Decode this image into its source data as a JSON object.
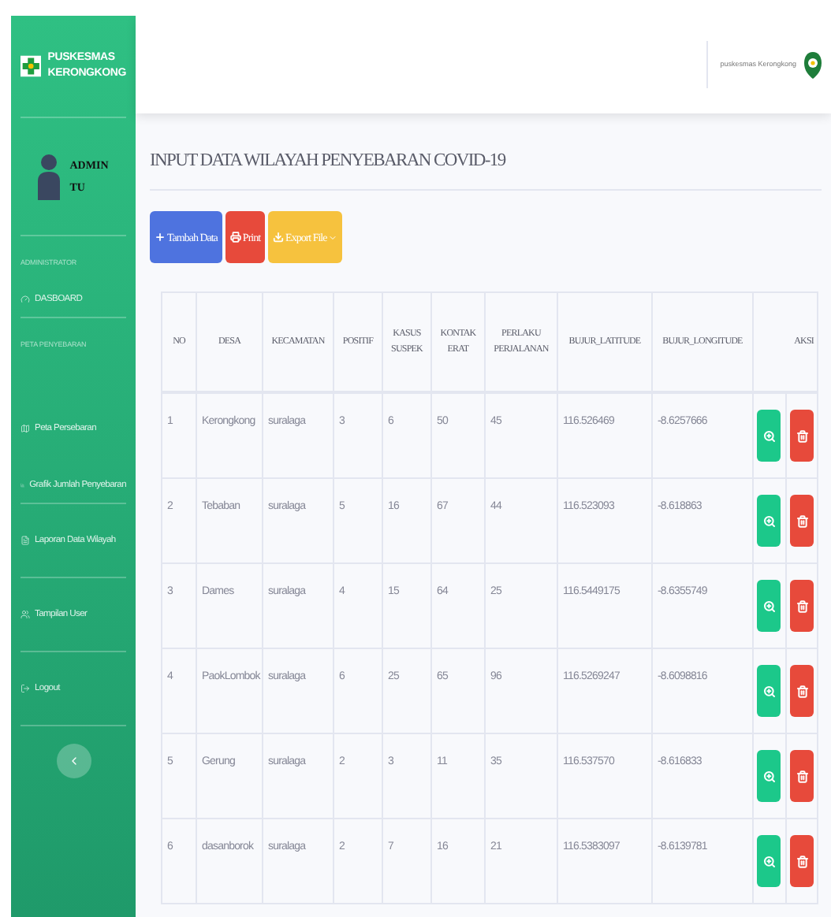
{
  "sidebar": {
    "brand": [
      "PUSKESMAS",
      "KERONGKONG"
    ],
    "user": [
      "ADMIN",
      "TU"
    ],
    "sections": [
      {
        "heading": "ADMINISTRATOR",
        "items": [
          {
            "label": "DASBOARD",
            "kind": "dashboard"
          }
        ]
      },
      {
        "heading": "PETA PENYEBARAN",
        "items": [
          {
            "label": "Peta Persebaran",
            "kind": "map"
          },
          {
            "label": "Grafik Jumlah Penyebaran",
            "kind": "chart"
          }
        ]
      },
      {
        "items": [
          {
            "label": "Laporan Data Wilayah",
            "kind": "report"
          }
        ]
      },
      {
        "items": [
          {
            "label": "Tampilan User",
            "kind": "users"
          }
        ]
      },
      {
        "items": [
          {
            "label": "Logout",
            "kind": "logout"
          }
        ]
      }
    ]
  },
  "topbar": {
    "user_label": "puskesmas Kerongkong"
  },
  "page_title": "INPUT DATA WILAYAH PENYEBARAN COVID-19",
  "buttons": [
    {
      "label": "Tambah Data",
      "kind": "add"
    },
    {
      "label": "Print",
      "kind": "print"
    },
    {
      "label": "Export File",
      "kind": "export"
    }
  ],
  "table": {
    "columns": [
      "NO",
      "DESA",
      "KECAMATAN",
      "POSITIF",
      "KASUS SUSPEK",
      "KONTAK ERAT",
      "PERLAKU PERJALANAN",
      "BUJUR_LATITUDE",
      "BUJUR_LONGITUDE",
      "AKSI"
    ],
    "rows": [
      [
        "1",
        "Kerongkong",
        "suralaga",
        "3",
        "6",
        "50",
        "45",
        "116.526469",
        "-8.6257666"
      ],
      [
        "2",
        "Tebaban",
        "suralaga",
        "5",
        "16",
        "67",
        "44",
        "116.523093",
        "-8.618863"
      ],
      [
        "3",
        "Dames",
        "suralaga",
        "4",
        "15",
        "64",
        "25",
        "116.5449175",
        "-8.6355749"
      ],
      [
        "4",
        "PaokLombok",
        "suralaga",
        "6",
        "25",
        "65",
        "96",
        "116.5269247",
        "-8.6098816"
      ],
      [
        "5",
        "Gerung",
        "suralaga",
        "2",
        "3",
        "11",
        "35",
        "116.537570",
        "-8.616833"
      ],
      [
        "6",
        "dasanborok",
        "suralaga",
        "2",
        "7",
        "16",
        "21",
        "116.5383097",
        "-8.6139781"
      ]
    ]
  }
}
